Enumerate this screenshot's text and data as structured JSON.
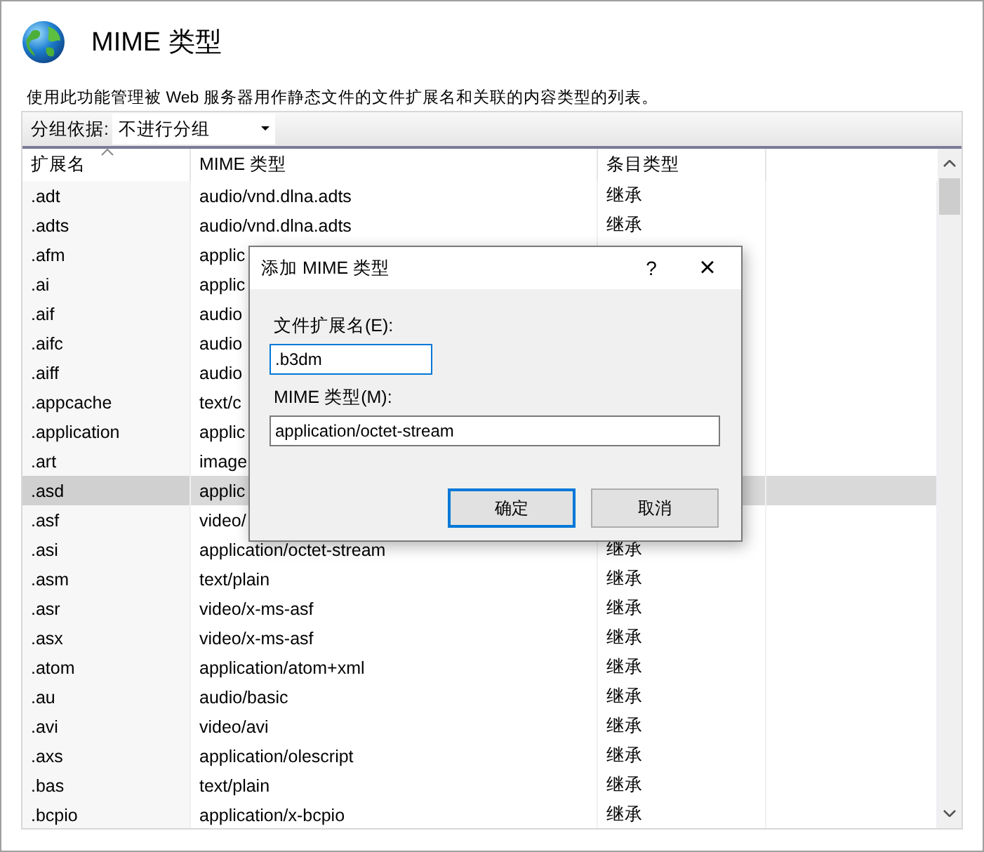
{
  "header": {
    "title": "MIME 类型"
  },
  "description": "使用此功能管理被 Web 服务器用作静态文件的文件扩展名和关联的内容类型的列表。",
  "toolbar": {
    "group_by_label": "分组依据:",
    "group_by_value": "不进行分组"
  },
  "table": {
    "columns": [
      {
        "label": "扩展名",
        "sorted": true
      },
      {
        "label": "MIME 类型",
        "sorted": false
      },
      {
        "label": "条目类型",
        "sorted": false
      }
    ],
    "rows": [
      {
        "extension": ".adt",
        "mime_type": "audio/vnd.dlna.adts",
        "entry_type": "继承",
        "selected": false
      },
      {
        "extension": ".adts",
        "mime_type": "audio/vnd.dlna.adts",
        "entry_type": "继承",
        "selected": false
      },
      {
        "extension": ".afm",
        "mime_type": "applic",
        "selected": false
      },
      {
        "extension": ".ai",
        "mime_type": "applic",
        "selected": false
      },
      {
        "extension": ".aif",
        "mime_type": "audio",
        "selected": false
      },
      {
        "extension": ".aifc",
        "mime_type": "audio",
        "selected": false
      },
      {
        "extension": ".aiff",
        "mime_type": "audio",
        "selected": false
      },
      {
        "extension": ".appcache",
        "mime_type": "text/c",
        "selected": false
      },
      {
        "extension": ".application",
        "mime_type": "applic",
        "selected": false
      },
      {
        "extension": ".art",
        "mime_type": "image",
        "selected": false
      },
      {
        "extension": ".asd",
        "mime_type": "applic",
        "selected": true
      },
      {
        "extension": ".asf",
        "mime_type": "video/",
        "selected": false
      },
      {
        "extension": ".asi",
        "mime_type": "application/octet-stream",
        "entry_type": "继承",
        "selected": false
      },
      {
        "extension": ".asm",
        "mime_type": "text/plain",
        "entry_type": "继承",
        "selected": false
      },
      {
        "extension": ".asr",
        "mime_type": "video/x-ms-asf",
        "entry_type": "继承",
        "selected": false
      },
      {
        "extension": ".asx",
        "mime_type": "video/x-ms-asf",
        "entry_type": "继承",
        "selected": false
      },
      {
        "extension": ".atom",
        "mime_type": "application/atom+xml",
        "entry_type": "继承",
        "selected": false
      },
      {
        "extension": ".au",
        "mime_type": "audio/basic",
        "entry_type": "继承",
        "selected": false
      },
      {
        "extension": ".avi",
        "mime_type": "video/avi",
        "entry_type": "继承",
        "selected": false
      },
      {
        "extension": ".axs",
        "mime_type": "application/olescript",
        "entry_type": "继承",
        "selected": false
      },
      {
        "extension": ".bas",
        "mime_type": "text/plain",
        "entry_type": "继承",
        "selected": false
      },
      {
        "extension": ".bcpio",
        "mime_type": "application/x-bcpio",
        "entry_type": "继承",
        "selected": false
      }
    ]
  },
  "dialog": {
    "title": "添加 MIME 类型",
    "help": "?",
    "close": "×",
    "fields": [
      {
        "label": "文件扩展名(E):",
        "value": ".b3dm",
        "focused": true
      },
      {
        "label": "MIME 类型(M):",
        "value": "application/octet-stream",
        "focused": false
      }
    ],
    "buttons": [
      {
        "label": "确定",
        "default": true
      },
      {
        "label": "取消",
        "default": false
      }
    ]
  }
}
